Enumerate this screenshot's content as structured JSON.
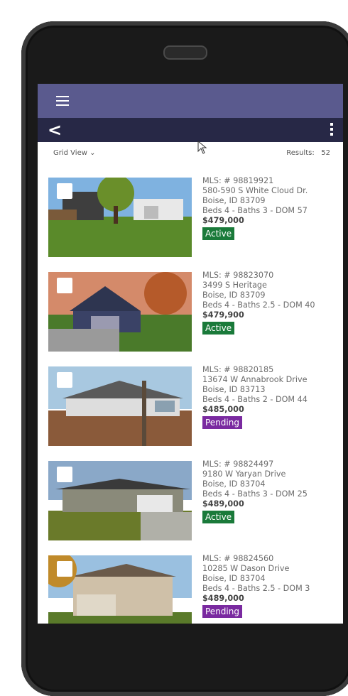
{
  "header": {
    "back_label": "<"
  },
  "toolbar": {
    "view_label": "Grid View",
    "results_label": "Results:",
    "results_count": "52"
  },
  "listings": [
    {
      "mls": "MLS: # 98819921",
      "address": "580-590 S White Cloud Dr.",
      "city": "Boise, ID 83709",
      "details": "Beds 4 -  Baths 3 -  DOM 57",
      "price": "$479,000",
      "status": "Active"
    },
    {
      "mls": "MLS: # 98823070",
      "address": "3499 S Heritage",
      "city": "Boise, ID 83709",
      "details": "Beds 4 -  Baths 2.5 -  DOM 40",
      "price": "$479,900",
      "status": "Active"
    },
    {
      "mls": "MLS: # 98820185",
      "address": "13674 W Annabrook Drive",
      "city": "Boise, ID 83713",
      "details": "Beds 4 -  Baths 2 -  DOM 44",
      "price": "$485,000",
      "status": "Pending"
    },
    {
      "mls": "MLS: # 98824497",
      "address": "9180 W Yaryan Drive",
      "city": "Boise, ID 83704",
      "details": "Beds 4 -  Baths 3 -  DOM 25",
      "price": "$489,000",
      "status": "Active"
    },
    {
      "mls": "MLS: # 98824560",
      "address": "10285 W Dason Drive",
      "city": "Boise, ID 83704",
      "details": "Beds 4 -  Baths 2.5 -  DOM 3",
      "price": "$489,000",
      "status": "Pending"
    }
  ],
  "colors": {
    "appbar": "#5a5a8e",
    "navbar": "#272846",
    "active": "#1a7a3a",
    "pending": "#7a2aa0"
  },
  "icons": {
    "menu": "hamburger-icon",
    "back": "chevron-left-icon",
    "more": "kebab-icon"
  }
}
